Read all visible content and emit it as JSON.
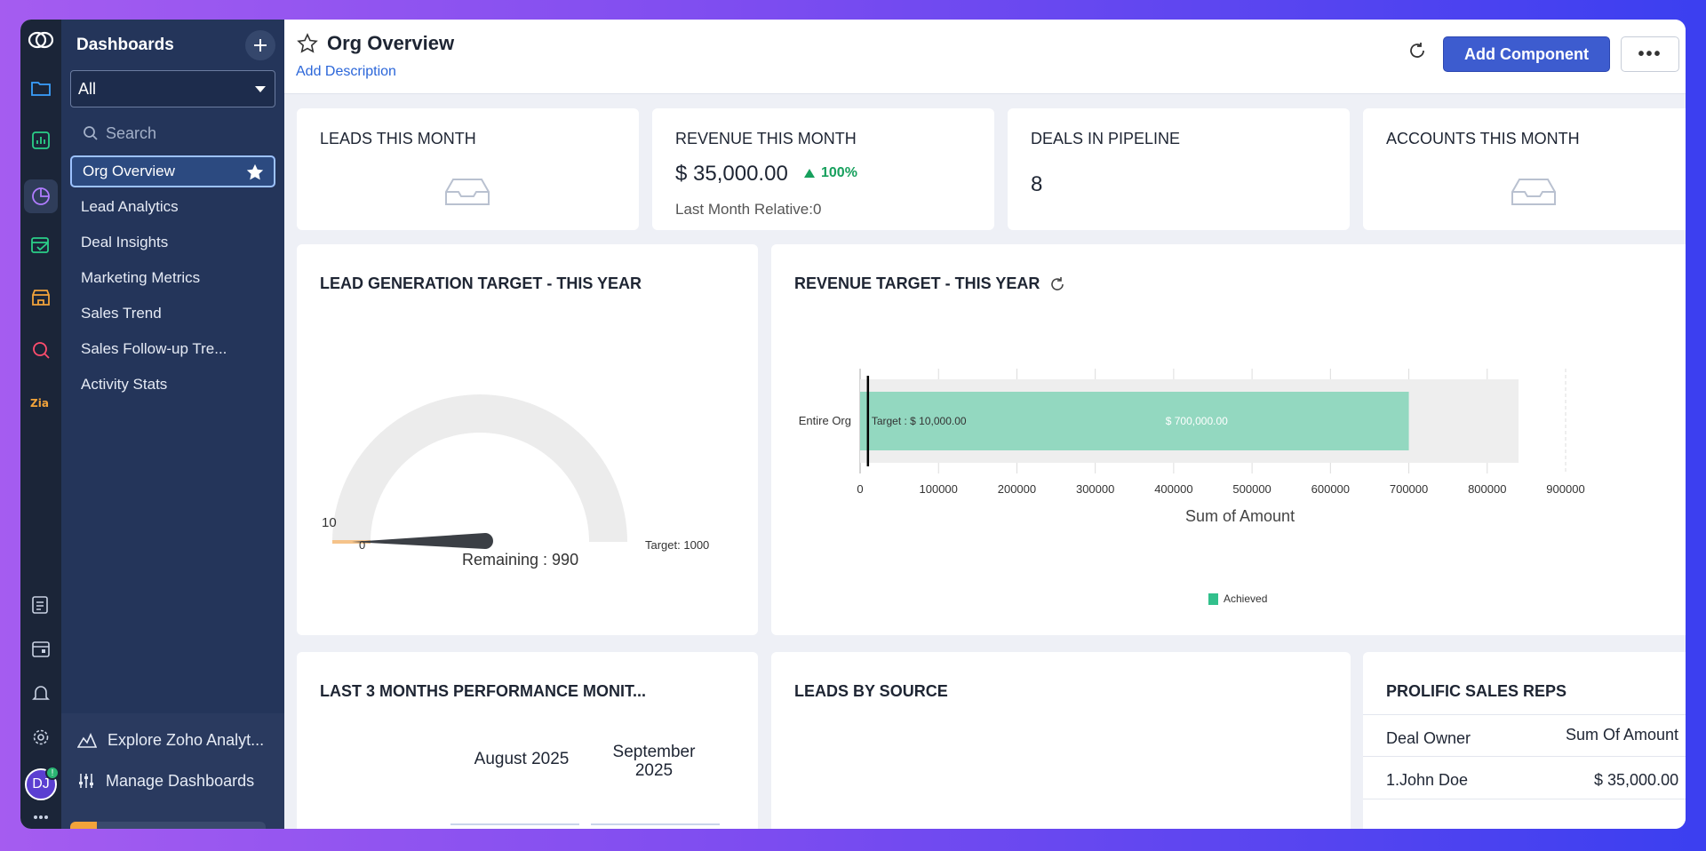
{
  "rail": {
    "icons": [
      "zoho-logo-icon",
      "folder-icon",
      "report-icon",
      "dashboard-icon",
      "planner-icon",
      "store-icon",
      "search-analytics-icon",
      "zia-icon",
      "notes-icon",
      "calendar-icon",
      "bell-icon",
      "gear-icon",
      "apps-grid-icon"
    ],
    "avatar_initials": "DJ",
    "avatar_badge": "!"
  },
  "sidebar": {
    "title": "Dashboards",
    "select_value": "All",
    "search_placeholder": "Search",
    "items": [
      {
        "label": "Org Overview"
      },
      {
        "label": "Lead Analytics"
      },
      {
        "label": "Deal Insights"
      },
      {
        "label": "Marketing Metrics"
      },
      {
        "label": "Sales Trend"
      },
      {
        "label": "Sales Follow-up Tre..."
      },
      {
        "label": "Activity Stats"
      }
    ],
    "bottom": {
      "explore": "Explore Zoho Analyt...",
      "manage": "Manage Dashboards"
    }
  },
  "header": {
    "title": "Org Overview",
    "add_description": "Add Description",
    "add_component": "Add Component",
    "more": "•••"
  },
  "cards": {
    "leads_month": {
      "title": "LEADS THIS MONTH"
    },
    "revenue_month": {
      "title": "REVENUE THIS MONTH",
      "value": "$ 35,000.00",
      "delta": "100%",
      "sub": "Last Month Relative:0"
    },
    "deals_pipeline": {
      "title": "DEALS IN PIPELINE",
      "value": "8"
    },
    "accounts_month": {
      "title": "ACCOUNTS THIS MONTH"
    },
    "lead_gen": {
      "title": "LEAD GENERATION TARGET - THIS YEAR",
      "value_label": "10",
      "min_label": "0",
      "target_label": "Target: 1000",
      "remaining": "Remaining : 990"
    },
    "revenue_target": {
      "title": "REVENUE TARGET - THIS YEAR",
      "xlabel": "Sum of Amount",
      "legend": "Achieved"
    },
    "last3": {
      "title": "LAST 3 MONTHS PERFORMANCE MONIT...",
      "col1": "August 2025",
      "col2": "September 2025"
    },
    "leads_source": {
      "title": "LEADS BY SOURCE"
    },
    "prolific": {
      "title": "PROLIFIC SALES REPS",
      "col_owner": "Deal Owner",
      "col_amount": "Sum Of Amount",
      "rows": [
        {
          "owner": "1.John Doe",
          "amount": "$ 35,000.00"
        }
      ]
    }
  },
  "chart_data": [
    {
      "type": "gauge",
      "title": "LEAD GENERATION TARGET - THIS YEAR",
      "value": 10,
      "min": 0,
      "target": 1000,
      "remaining": 990
    },
    {
      "type": "bar",
      "title": "REVENUE TARGET - THIS YEAR",
      "categories": [
        "Entire Org"
      ],
      "series": [
        {
          "name": "Achieved",
          "values": [
            700000
          ]
        }
      ],
      "target": 10000,
      "target_label": "Target : $ 10,000.00",
      "value_label": "$ 700,000.00",
      "xlabel": "Sum of Amount",
      "xticks": [
        0,
        100000,
        200000,
        300000,
        400000,
        500000,
        600000,
        700000,
        800000,
        900000
      ],
      "xlim": [
        0,
        900000
      ],
      "background_max": 840000,
      "orientation": "horizontal",
      "colors": {
        "achieved": "#93d8c0",
        "background": "#eeeeee",
        "target_marker": "#000000"
      }
    }
  ]
}
